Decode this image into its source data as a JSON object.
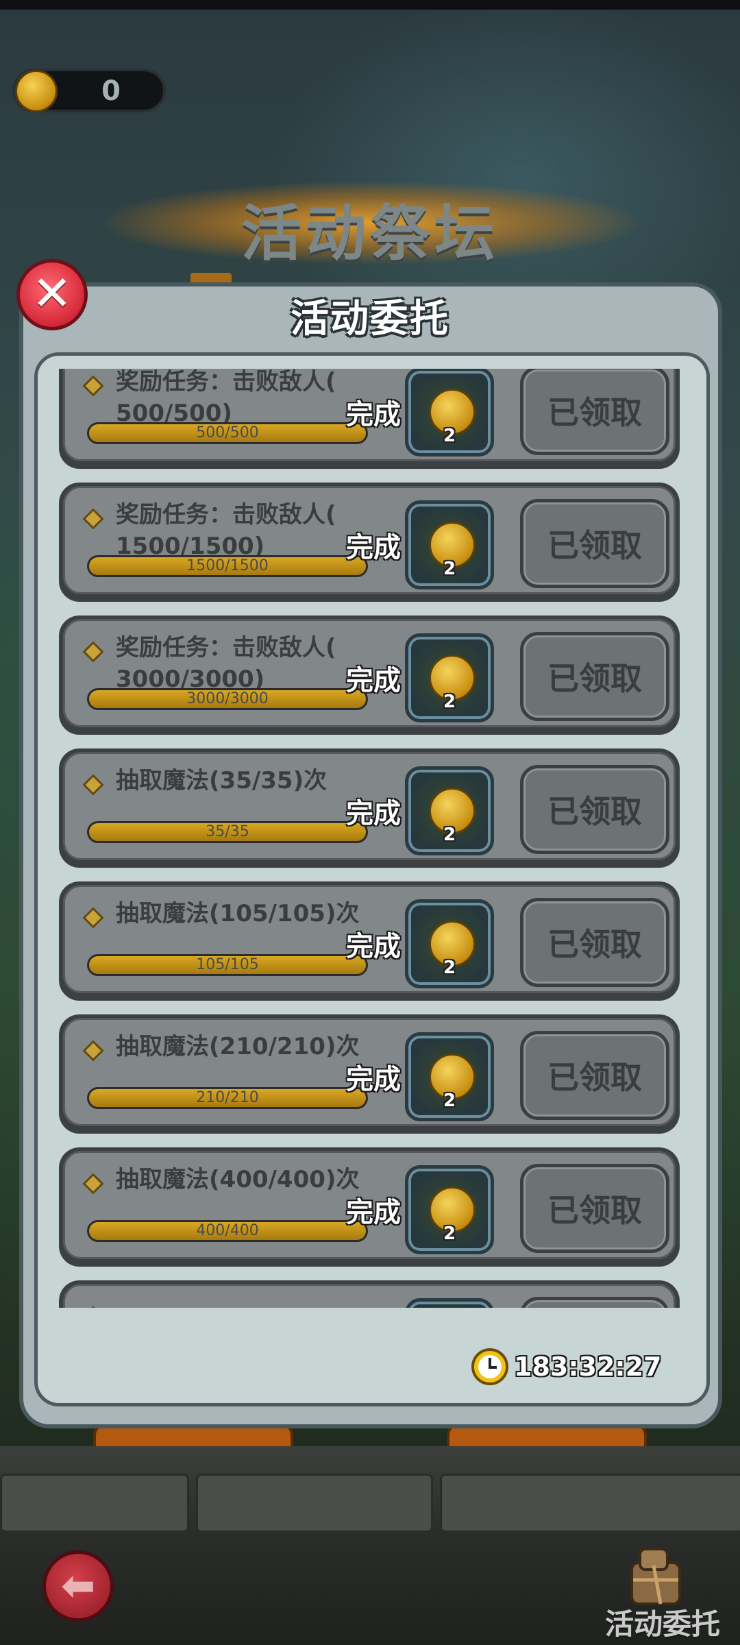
{
  "header": {
    "coin_count": "0",
    "altar_title": "活动祭坛"
  },
  "dialog": {
    "title": "活动委托",
    "close_icon": "close-x-icon",
    "timer": "183:32:27",
    "tasks": [
      {
        "text": "奖励任务：击败敌人(\n500/500)",
        "progress_label": "500/500",
        "progress": 1.0,
        "status": "完成",
        "reward_count": "2",
        "button": "已领取"
      },
      {
        "text": "奖励任务：击败敌人(\n1500/1500)",
        "progress_label": "1500/1500",
        "progress": 1.0,
        "status": "完成",
        "reward_count": "2",
        "button": "已领取"
      },
      {
        "text": "奖励任务：击败敌人(\n3000/3000)",
        "progress_label": "3000/3000",
        "progress": 1.0,
        "status": "完成",
        "reward_count": "2",
        "button": "已领取"
      },
      {
        "text": "抽取魔法(35/35)次",
        "progress_label": "35/35",
        "progress": 1.0,
        "status": "完成",
        "reward_count": "2",
        "button": "已领取"
      },
      {
        "text": "抽取魔法(105/105)次",
        "progress_label": "105/105",
        "progress": 1.0,
        "status": "完成",
        "reward_count": "2",
        "button": "已领取"
      },
      {
        "text": "抽取魔法(210/210)次",
        "progress_label": "210/210",
        "progress": 1.0,
        "status": "完成",
        "reward_count": "2",
        "button": "已领取"
      },
      {
        "text": "抽取魔法(400/400)次",
        "progress_label": "400/400",
        "progress": 1.0,
        "status": "完成",
        "reward_count": "2",
        "button": "已领取"
      }
    ]
  },
  "footer": {
    "quest_label": "活动委托",
    "back_icon": "back-arrow-icon"
  },
  "colors": {
    "panel_bg": "#a9b7ba",
    "inner_bg": "#c7d6d5",
    "progress_fill": "#d9a823",
    "close_red": "#d92c3c",
    "coin_gold": "#f3c21a"
  }
}
